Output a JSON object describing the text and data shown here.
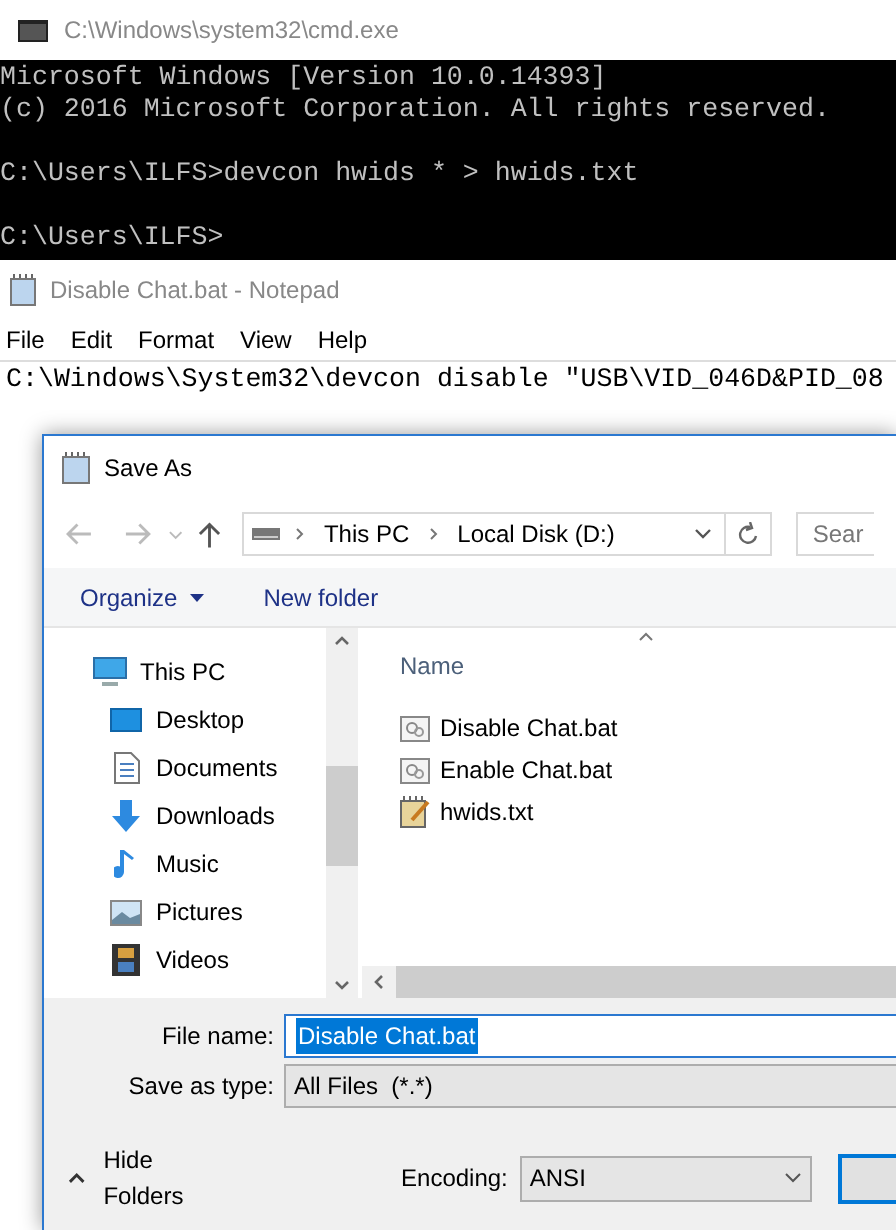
{
  "console_window": {
    "title": "C:\\Windows\\system32\\cmd.exe",
    "blocks": [
      [
        "Microsoft Windows [Version 10.0.14393]",
        "(c) 2016 Microsoft Corporation. All rights reserved."
      ],
      [
        "C:\\Users\\ILFS>devcon hwids * > hwids.txt"
      ],
      [
        "C:\\Users\\ILFS>"
      ]
    ]
  },
  "notepad_window": {
    "title": "Disable Chat.bat - Notepad",
    "menu": [
      "File",
      "Edit",
      "Format",
      "View",
      "Help"
    ],
    "text": "C:\\Windows\\System32\\devcon disable \"USB\\VID_046D&PID_08"
  },
  "save_dialog": {
    "title": "Save As",
    "breadcrumb": [
      "This PC",
      "Local Disk (D:)"
    ],
    "search_placeholder": "Sear",
    "toolbar": [
      "Organize",
      "New folder"
    ],
    "sidebar": [
      {
        "label": "This PC",
        "kind": "pc"
      },
      {
        "label": "Desktop",
        "kind": "desktop"
      },
      {
        "label": "Documents",
        "kind": "documents"
      },
      {
        "label": "Downloads",
        "kind": "downloads"
      },
      {
        "label": "Music",
        "kind": "music"
      },
      {
        "label": "Pictures",
        "kind": "pictures"
      },
      {
        "label": "Videos",
        "kind": "videos"
      }
    ],
    "column": "Name",
    "files": [
      {
        "name": "Disable Chat.bat",
        "kind": "bat"
      },
      {
        "name": "Enable Chat.bat",
        "kind": "bat"
      },
      {
        "name": "hwids.txt",
        "kind": "txt"
      }
    ],
    "file_name_label": "File name:",
    "file_name": "Disable Chat.bat",
    "type_label": "Save as type:",
    "type": "All Files  (*.*)",
    "hide_folders": "Hide Folders",
    "encoding_label": "Encoding:",
    "encoding": "ANSI"
  }
}
